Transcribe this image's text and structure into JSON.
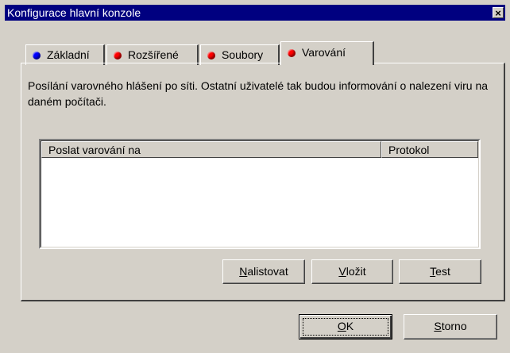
{
  "window": {
    "title": "Konfigurace hlavní konzole",
    "close_symbol": "×"
  },
  "tabs": [
    {
      "label": "Základní",
      "dot_color": "#0000ff"
    },
    {
      "label": "Rozšířené",
      "dot_color": "#ff0000"
    },
    {
      "label": "Soubory",
      "dot_color": "#ff0000"
    },
    {
      "label": "Varování",
      "dot_color": "#ff0000",
      "active": true
    }
  ],
  "panel": {
    "description": "Posílání varovného hlášení po síti. Ostatní uživatelé tak budou informování o nalezení viru na daném počítači.",
    "list": {
      "columns": [
        "Poslat varování na",
        "Protokol"
      ],
      "rows": []
    },
    "buttons": {
      "list_first": "N",
      "list_rest": "alistovat",
      "insert_first": "V",
      "insert_rest": "ložit",
      "test_first": "T",
      "test_rest": "est"
    }
  },
  "footer": {
    "ok_first": "O",
    "ok_rest": "K",
    "cancel_first": "S",
    "cancel_rest": "torno"
  }
}
